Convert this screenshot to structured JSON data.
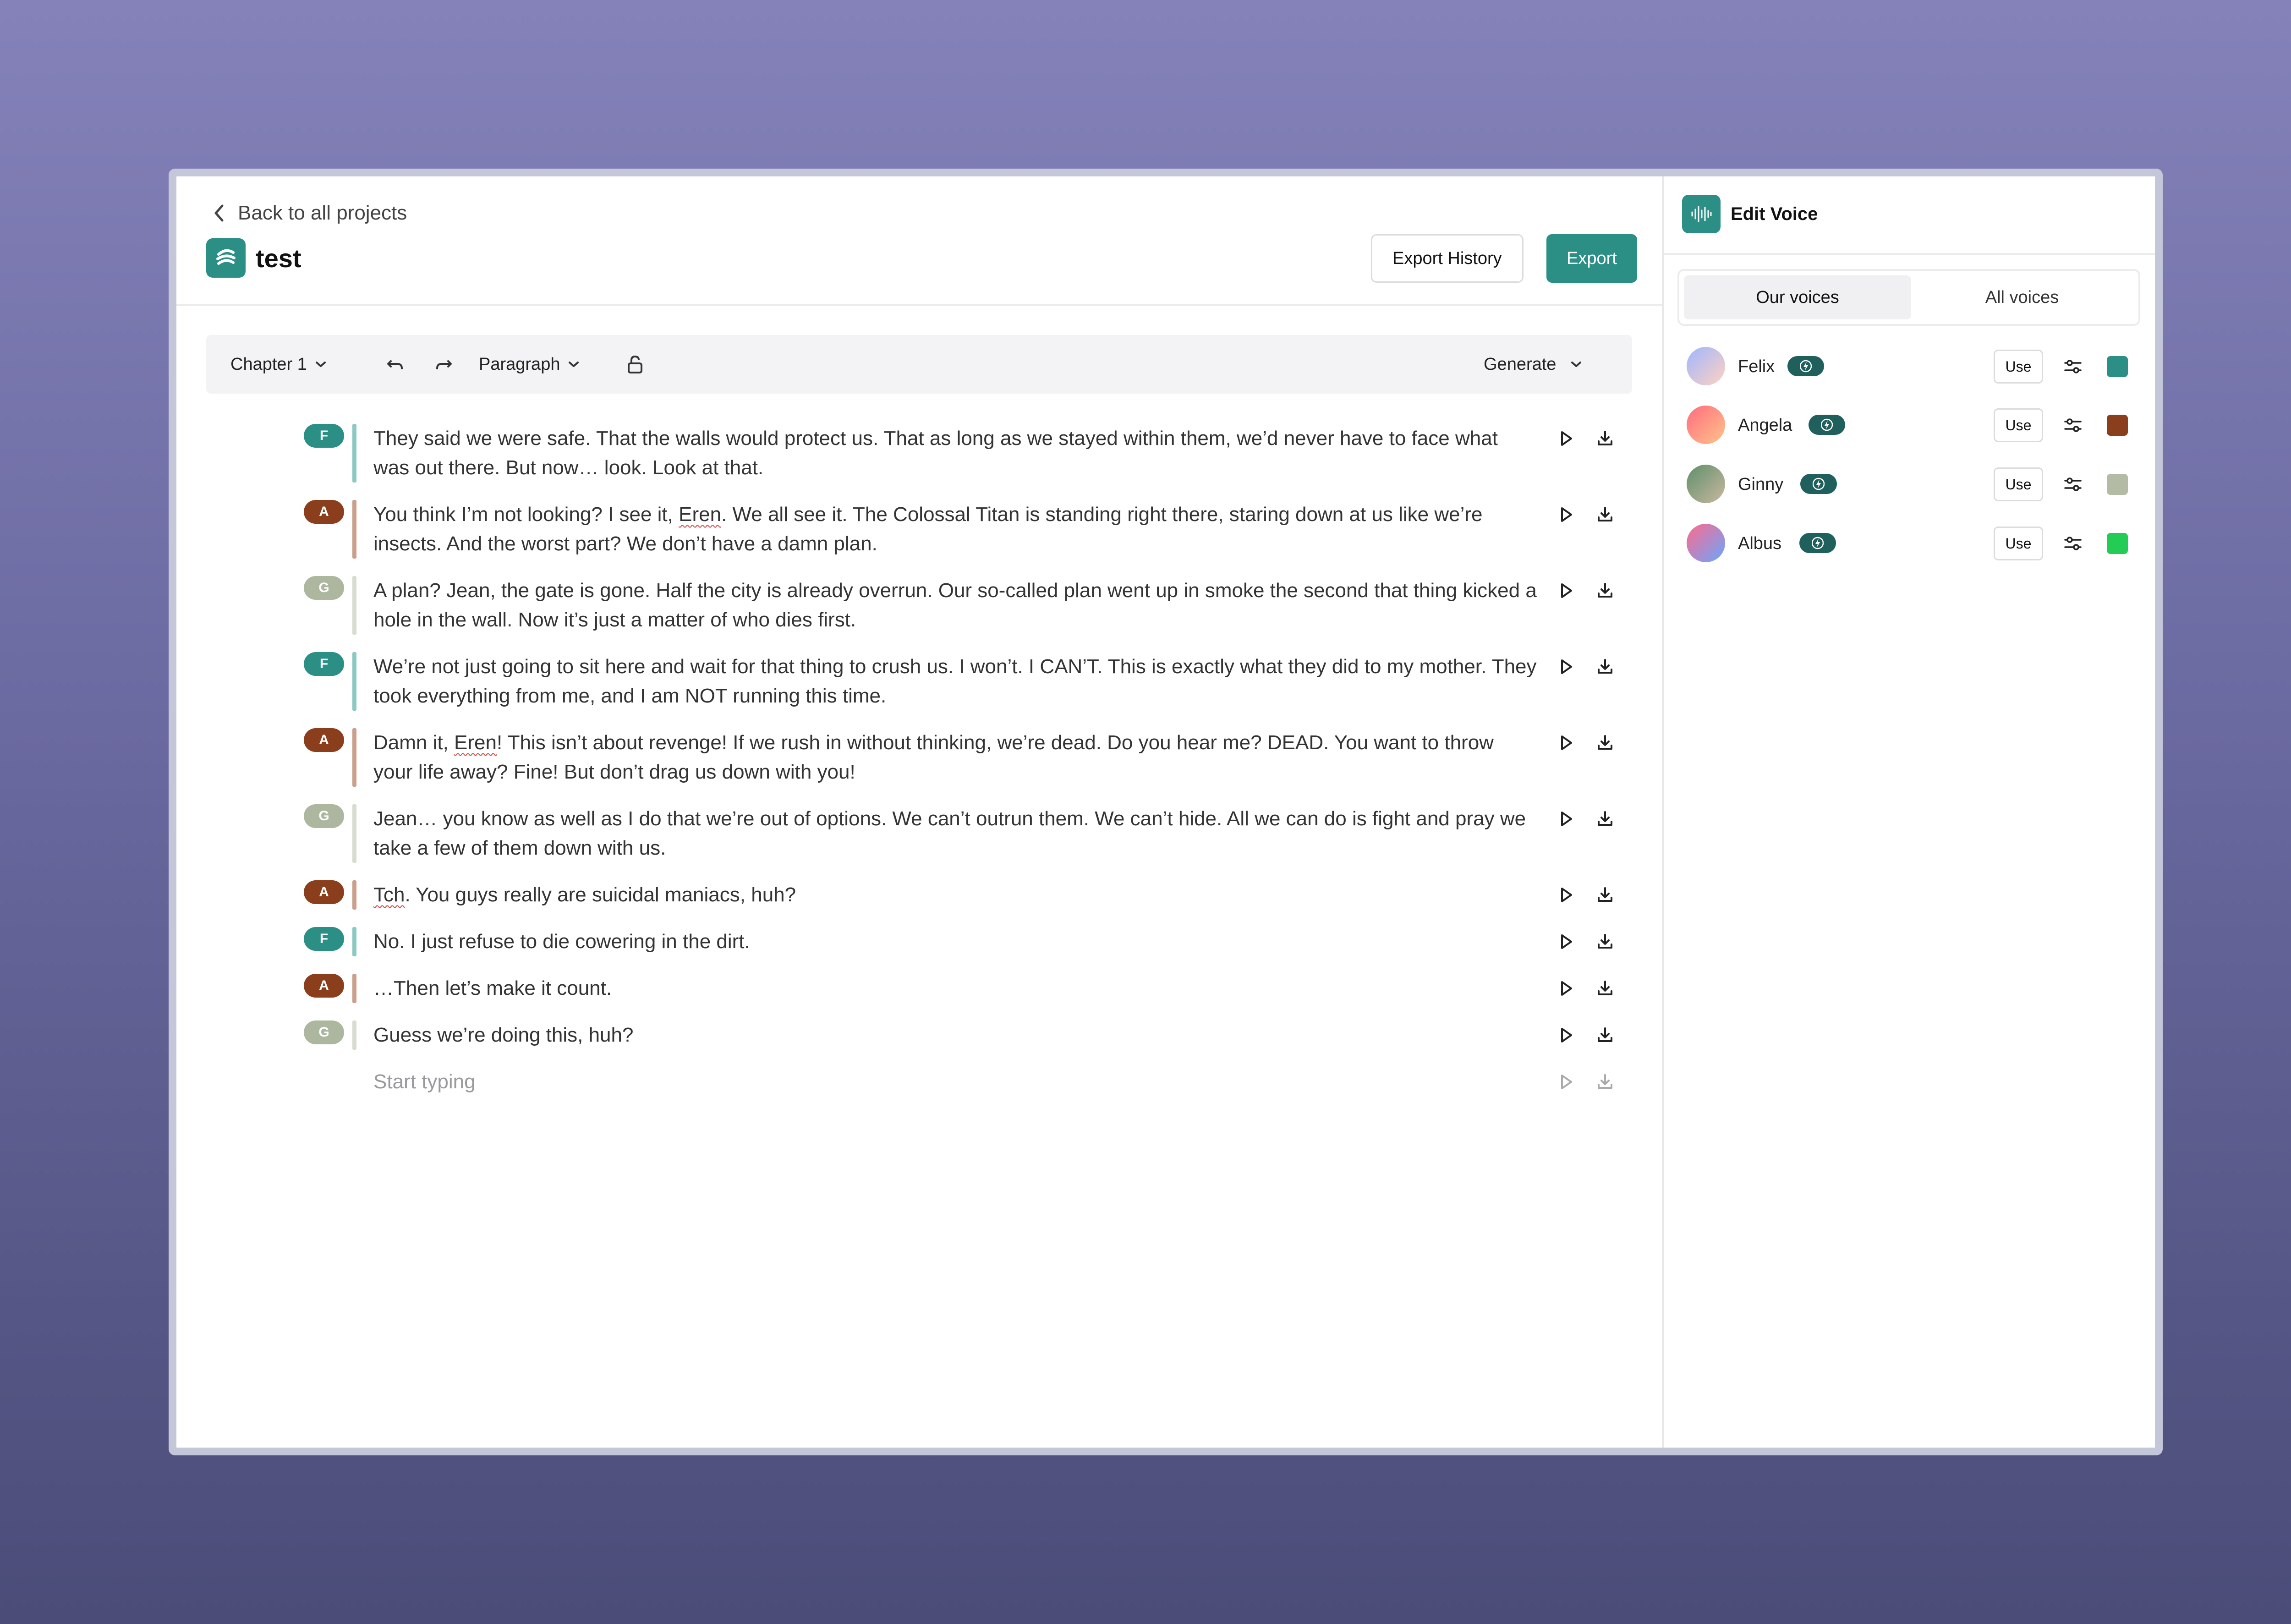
{
  "header": {
    "back_label": "Back to all projects",
    "project_title": "test",
    "export_history_label": "Export History",
    "export_label": "Export"
  },
  "toolbar": {
    "chapter_label": "Chapter 1",
    "mode_label": "Paragraph",
    "generate_label": "Generate",
    "icons": [
      "undo-icon",
      "redo-icon",
      "lock-icon"
    ]
  },
  "lines": [
    {
      "speaker": "F",
      "color": "#2b8f86",
      "bar_color": "#8cc9c1",
      "rows": 2,
      "text": "They said we were safe. That the walls would protect us. That as long as we stayed within them, we’d never have to face what was out there. But now… look. Look at that."
    },
    {
      "speaker": "A",
      "color": "#8a3e1c",
      "bar_color": "#caa08c",
      "rows": 2,
      "text": "You think I’m not looking? I see it, Eren. We all see it. The Colossal Titan is standing right there, staring down at us like we’re insects. And the worst part? We don’t have a damn plan."
    },
    {
      "speaker": "G",
      "color": "#adb79f",
      "bar_color": "#d8dcd0",
      "rows": 2,
      "text": "A plan? Jean, the gate is gone. Half the city is already overrun. Our so-called plan went up in smoke the second that thing kicked a hole in the wall. Now it’s just a matter of who dies first."
    },
    {
      "speaker": "F",
      "color": "#2b8f86",
      "bar_color": "#8cc9c1",
      "rows": 2,
      "text": "We’re not just going to sit here and wait for that thing to crush us. I won’t. I CAN’T. This is exactly what they did to my mother. They took everything from me, and I am NOT running this time."
    },
    {
      "speaker": "A",
      "color": "#8a3e1c",
      "bar_color": "#caa08c",
      "rows": 2,
      "text": "Damn it, Eren! This isn’t about revenge! If we rush in without thinking, we’re dead. Do you hear me? DEAD. You want to throw your life away? Fine! But don’t drag us down with you!"
    },
    {
      "speaker": "G",
      "color": "#adb79f",
      "bar_color": "#d8dcd0",
      "rows": 2,
      "text": "Jean… you know as well as I do that we’re out of options. We can’t outrun them. We can’t hide. All we can do is fight and pray we take a few of them down with us."
    },
    {
      "speaker": "A",
      "color": "#8a3e1c",
      "bar_color": "#caa08c",
      "rows": 1,
      "text": "Tch. You guys really are suicidal maniacs, huh?"
    },
    {
      "speaker": "F",
      "color": "#2b8f86",
      "bar_color": "#8cc9c1",
      "rows": 1,
      "text": "No. I just refuse to die cowering in the dirt."
    },
    {
      "speaker": "A",
      "color": "#8a3e1c",
      "bar_color": "#caa08c",
      "rows": 1,
      "text": "…Then let’s make it count."
    },
    {
      "speaker": "G",
      "color": "#adb79f",
      "bar_color": "#d8dcd0",
      "rows": 1,
      "text": "Guess we’re doing this, huh?"
    }
  ],
  "placeholder": "Start typing",
  "side": {
    "title": "Edit Voice",
    "tabs": [
      "Our voices",
      "All voices"
    ],
    "use_label": "Use",
    "voices": [
      {
        "name": "Felix",
        "color": "#2b8f86",
        "avatar": [
          "#9fb6ff",
          "#ffd2c0"
        ]
      },
      {
        "name": "Angela",
        "color": "#8a3e1c",
        "avatar": [
          "#ff6b7e",
          "#ffc48a"
        ]
      },
      {
        "name": "Ginny",
        "color": "#b3bba4",
        "avatar": [
          "#5f8f6a",
          "#c9b8a0"
        ]
      },
      {
        "name": "Albus",
        "color": "#22cc55",
        "avatar": [
          "#ff6a8a",
          "#6aa6ff"
        ]
      }
    ]
  }
}
